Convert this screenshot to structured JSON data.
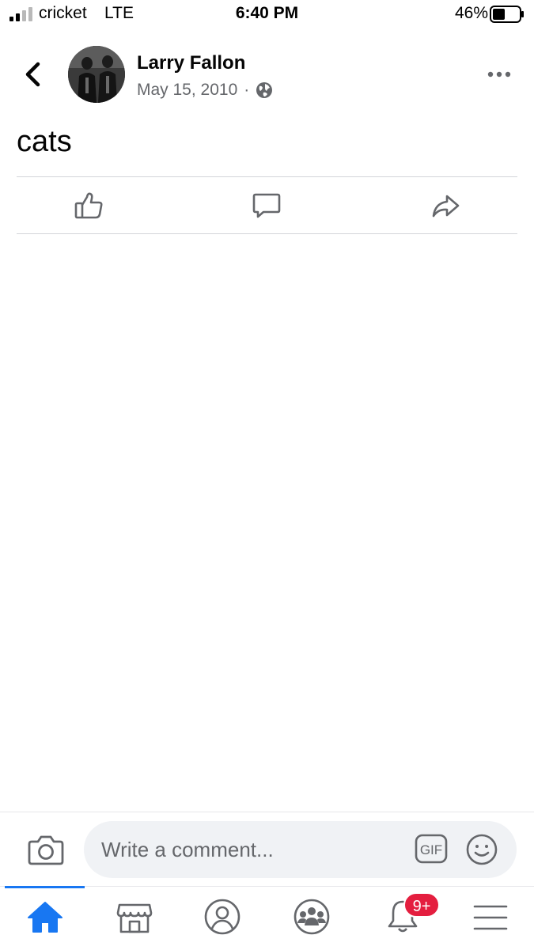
{
  "status_bar": {
    "carrier": "cricket",
    "network": "LTE",
    "time": "6:40 PM",
    "battery_percent": "46%",
    "battery_level": 0.46
  },
  "post": {
    "author": "Larry Fallon",
    "date": "May 15, 2010",
    "separator": "·",
    "privacy_icon": "globe-icon",
    "text": "cats"
  },
  "actions": {
    "like_icon": "thumbs-up-icon",
    "comment_icon": "comment-bubble-icon",
    "share_icon": "share-arrow-icon"
  },
  "composer": {
    "placeholder": "Write a comment...",
    "gif_label": "GIF"
  },
  "tabbar": {
    "active_tab": "home",
    "tabs": [
      "home-icon",
      "marketplace-icon",
      "profile-icon",
      "groups-icon",
      "notifications-icon",
      "menu-icon"
    ],
    "notification_badge": "9+"
  },
  "colors": {
    "accent": "#1877f2",
    "badge": "#e41e3f",
    "secondary_text": "#65676b",
    "icon_gray": "#65676b"
  }
}
